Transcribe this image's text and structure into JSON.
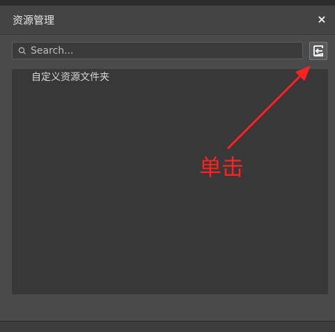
{
  "window": {
    "title": "资源管理",
    "close_label": "×"
  },
  "search": {
    "placeholder": "Search..."
  },
  "import_button": {
    "icon": "import-folder-icon"
  },
  "tree": {
    "items": [
      {
        "label": "自定义资源文件夹"
      }
    ]
  },
  "annotation": {
    "label": "单击",
    "color": "#ff2020"
  }
}
